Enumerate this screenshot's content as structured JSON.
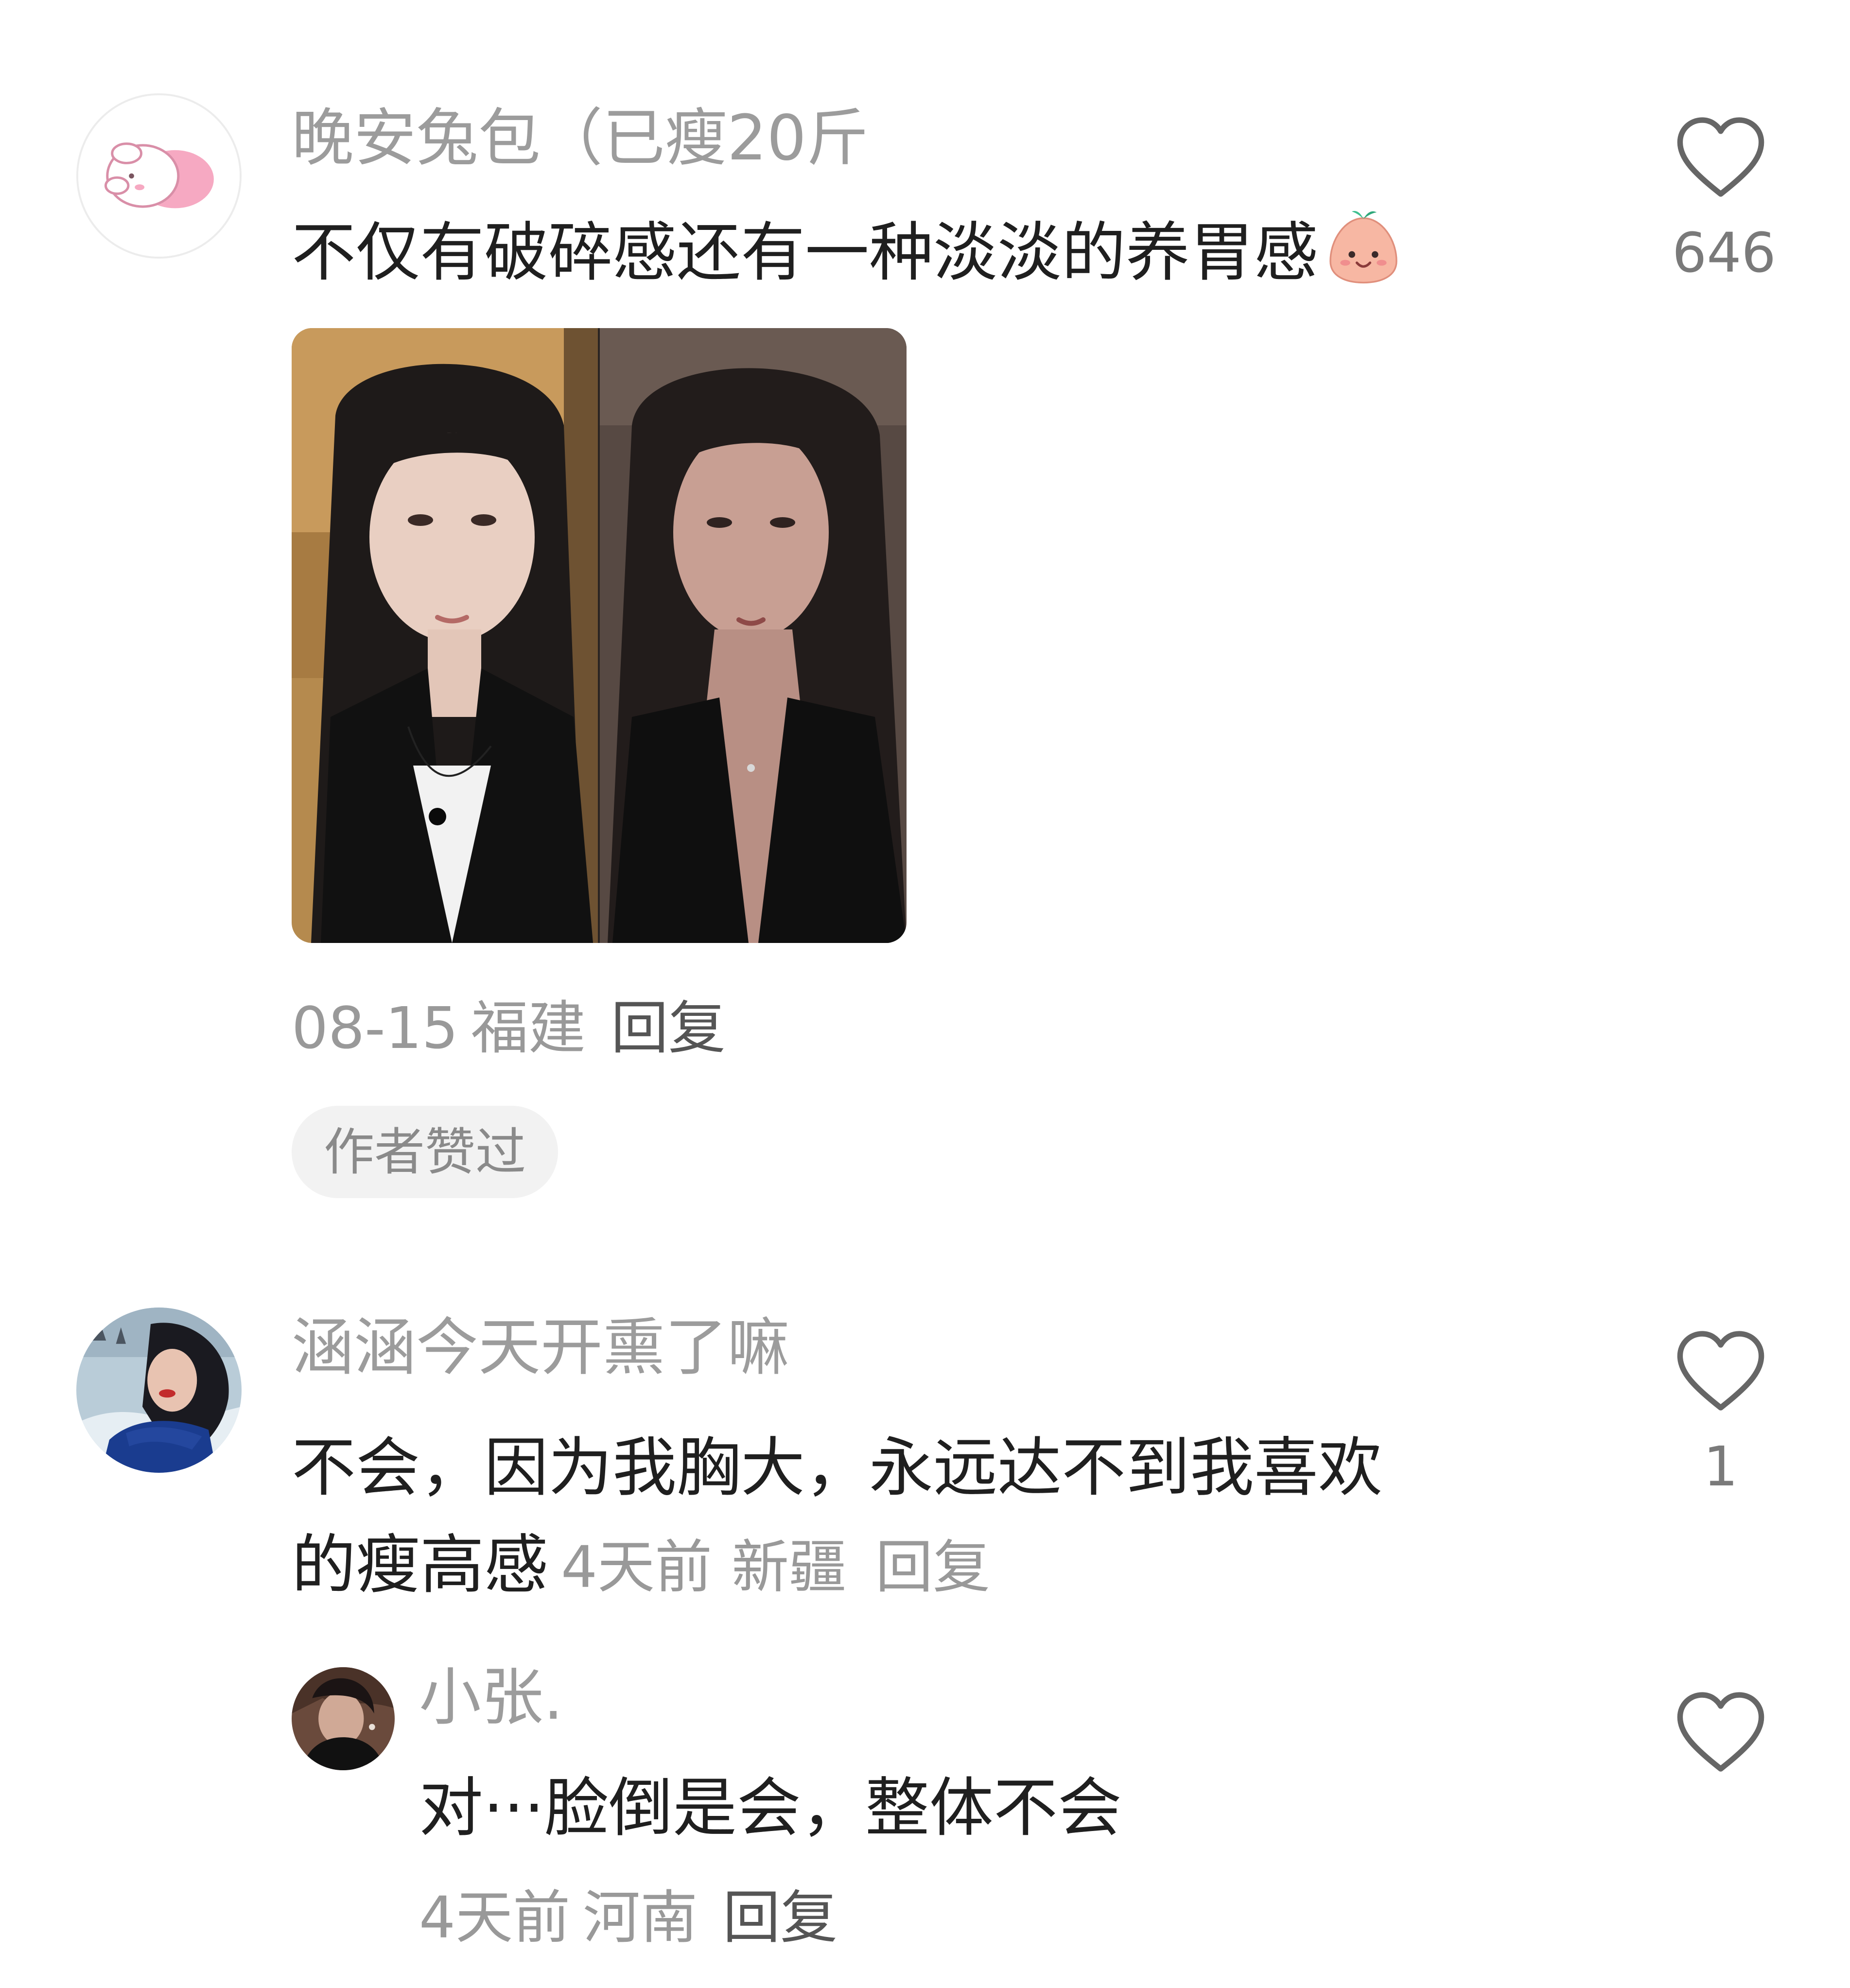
{
  "comments": [
    {
      "username": "晚安兔包（已瘦20斤",
      "text": "不仅有破碎感还有一种淡淡的养胃感",
      "emoji": "smiling-blob-emoji",
      "date": "08-15",
      "location": "福建",
      "reply_label": "回复",
      "badge": "作者赞过",
      "like_count": "646"
    },
    {
      "username": "涵涵今天开熏了嘛",
      "text_line1": "不会，因为我胸大，永远达不到我喜欢",
      "text_line2": "的瘦高感",
      "date": "4天前",
      "location": "新疆",
      "reply_label": "回复",
      "like_count": "1",
      "replies": [
        {
          "username": "小张.",
          "text": "对···脸倒是会，整体不会",
          "date": "4天前",
          "location": "河南",
          "reply_label": "回复"
        }
      ]
    }
  ],
  "icons": {
    "like": "heart-outline-icon"
  },
  "colors": {
    "username": "#9c9c9c",
    "text": "#1f1f1f",
    "meta": "#999999",
    "badge_bg": "#f2f2f2"
  }
}
